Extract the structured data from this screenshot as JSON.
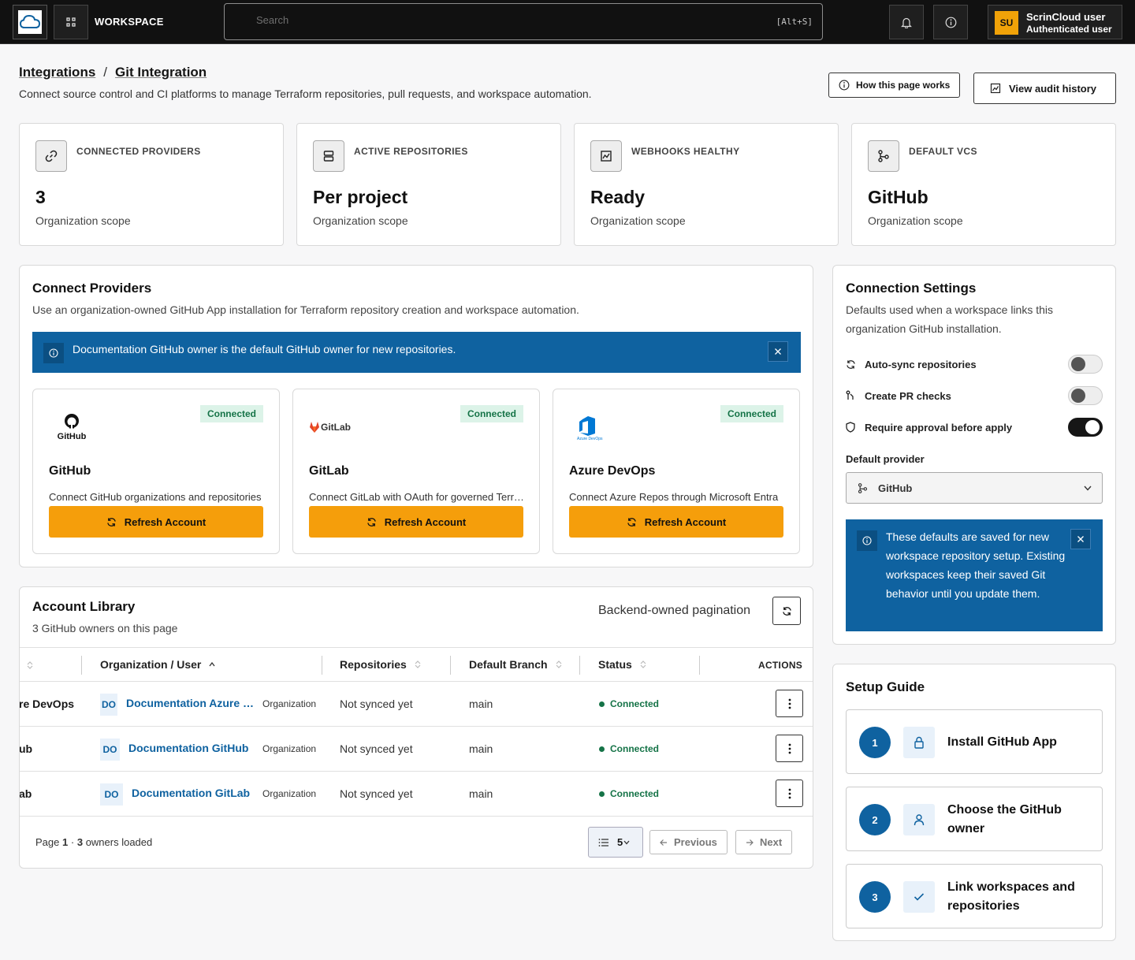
{
  "topbar": {
    "workspace_label": "WORKSPACE",
    "search_placeholder": "Search",
    "search_shortcut": "[Alt+S]",
    "user_initials": "SU",
    "user_name": "ScrinCloud user",
    "user_role": "Authenticated user"
  },
  "header": {
    "breadcrumb": [
      "Integrations",
      "Git Integration"
    ],
    "breadcrumb_sep": "/",
    "description": "Connect source control and CI platforms to manage Terraform repositories, pull requests, and workspace automation.",
    "how_button": "How this page works",
    "audit_button": "View audit history"
  },
  "stats": [
    {
      "label": "CONNECTED PROVIDERS",
      "value": "3",
      "sub": "Organization scope",
      "icon": "link-icon"
    },
    {
      "label": "ACTIVE REPOSITORIES",
      "value": "Per project",
      "sub": "Organization scope",
      "icon": "server-icon"
    },
    {
      "label": "WEBHOOKS HEALTHY",
      "value": "Ready",
      "sub": "Organization scope",
      "icon": "activity-icon"
    },
    {
      "label": "DEFAULT VCS",
      "value": "GitHub",
      "sub": "Organization scope",
      "icon": "git-branch-icon"
    }
  ],
  "connect": {
    "title": "Connect Providers",
    "subtitle": "Use an organization-owned GitHub App installation for Terraform repository creation and workspace automation.",
    "banner": "Documentation GitHub owner is the default GitHub owner for new repositories.",
    "providers": [
      {
        "name": "GitHub",
        "badge": "Connected",
        "desc": "Connect GitHub organizations and repositories",
        "button": "Refresh Account",
        "logo_text": "GitHub"
      },
      {
        "name": "GitLab",
        "badge": "Connected",
        "desc": "Connect GitLab with OAuth for governed Terraform",
        "button": "Refresh Account",
        "logo_text": "GitLab"
      },
      {
        "name": "Azure DevOps",
        "badge": "Connected",
        "desc": "Connect Azure Repos through Microsoft Entra",
        "button": "Refresh Account",
        "logo_text": "Azure DevOps"
      }
    ]
  },
  "library": {
    "title": "Account Library",
    "subtitle": "3 GitHub owners on this page",
    "pagination_label": "Backend-owned pagination",
    "columns": [
      "Organization / User",
      "Repositories",
      "Default Branch",
      "Status",
      "ACTIONS"
    ],
    "rows": [
      {
        "provider": "re DevOps",
        "badge": "DO",
        "org": "Documentation Azure DevOps",
        "type": "Organization",
        "repos": "Not synced yet",
        "branch": "main",
        "status": "Connected"
      },
      {
        "provider": "ub",
        "badge": "DO",
        "org": "Documentation GitHub",
        "type": "Organization",
        "repos": "Not synced yet",
        "branch": "main",
        "status": "Connected"
      },
      {
        "provider": "ab",
        "badge": "DO",
        "org": "Documentation GitLab",
        "type": "Organization",
        "repos": "Not synced yet",
        "branch": "main",
        "status": "Connected"
      }
    ],
    "footer_page_label": "Page",
    "footer_page": "1",
    "footer_sep": "·",
    "footer_count": "3",
    "footer_suffix": "owners loaded",
    "page_size": "5",
    "prev_label": "Previous",
    "next_label": "Next"
  },
  "settings": {
    "title": "Connection Settings",
    "subtitle": "Defaults used when a workspace links this organization GitHub installation.",
    "toggles": [
      {
        "label": "Auto-sync repositories",
        "on": false,
        "icon": "refresh-icon"
      },
      {
        "label": "Create PR checks",
        "on": false,
        "icon": "pull-request-icon"
      },
      {
        "label": "Require approval before apply",
        "on": true,
        "icon": "shield-icon"
      }
    ],
    "default_provider_label": "Default provider",
    "default_provider_value": "GitHub",
    "notice": "These defaults are saved for new workspace repository setup. Existing workspaces keep their saved Git behavior until you update them."
  },
  "guide": {
    "title": "Setup Guide",
    "steps": [
      {
        "num": "1",
        "label": "Install GitHub App",
        "icon": "lock-icon"
      },
      {
        "num": "2",
        "label": "Choose the GitHub owner",
        "icon": "user-icon"
      },
      {
        "num": "3",
        "label": "Link workspaces and repositories",
        "icon": "check-icon"
      }
    ]
  },
  "colors": {
    "accent_blue": "#0f62a0",
    "orange_button": "#f59e0b",
    "success": "#157347",
    "topbar": "#111111"
  }
}
